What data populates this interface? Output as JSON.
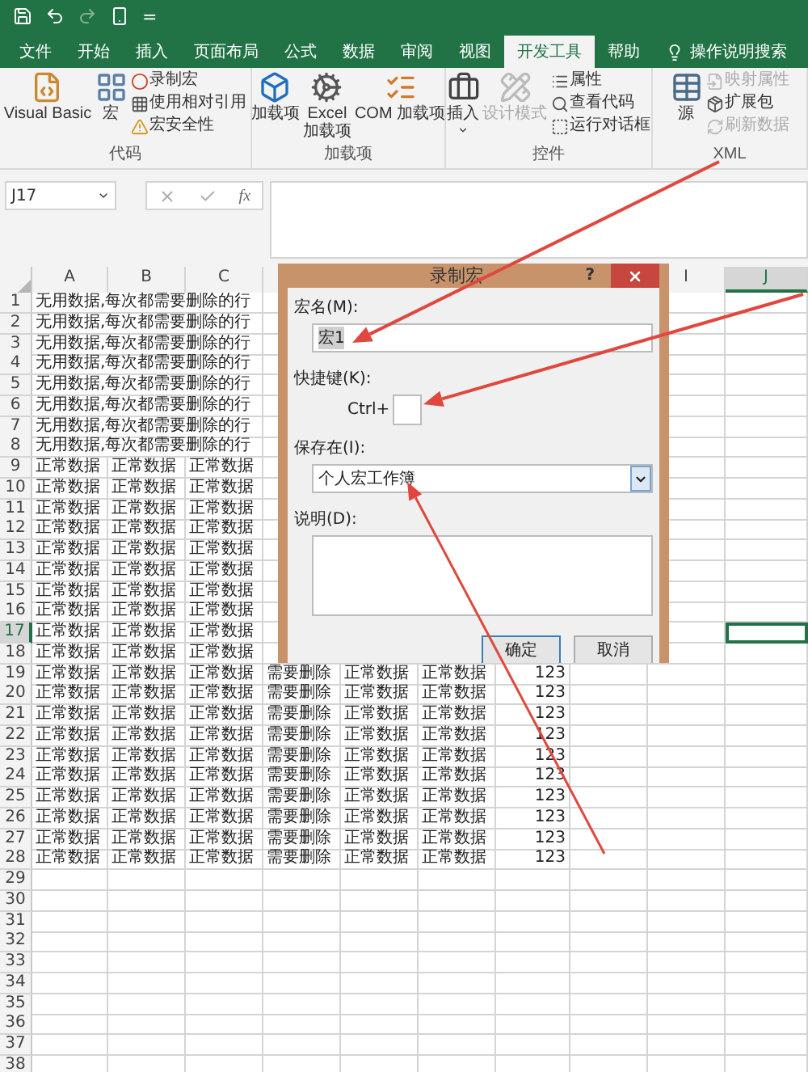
{
  "quick_access": {
    "customize": "="
  },
  "tabs": [
    {
      "label": "文件",
      "selected": false
    },
    {
      "label": "开始",
      "selected": false
    },
    {
      "label": "插入",
      "selected": false
    },
    {
      "label": "页面布局",
      "selected": false
    },
    {
      "label": "公式",
      "selected": false
    },
    {
      "label": "数据",
      "selected": false
    },
    {
      "label": "审阅",
      "selected": false
    },
    {
      "label": "视图",
      "selected": false
    },
    {
      "label": "开发工具",
      "selected": true
    },
    {
      "label": "帮助",
      "selected": false
    },
    {
      "label": "操作说明搜索",
      "selected": false,
      "kind": "search"
    }
  ],
  "ribbon": {
    "groups": [
      {
        "label": "代码",
        "items": [
          {
            "label": "Visual Basic",
            "kind": "large",
            "disabled": false
          },
          {
            "label": "宏",
            "kind": "large",
            "disabled": false
          },
          {
            "label": "录制宏",
            "kind": "small",
            "disabled": false
          },
          {
            "label": "使用相对引用",
            "kind": "small",
            "disabled": false
          },
          {
            "label": "宏安全性",
            "kind": "small",
            "disabled": false
          }
        ]
      },
      {
        "label": "加载项",
        "items": [
          {
            "label": "加载项",
            "kind": "large",
            "disabled": false
          },
          {
            "label": "Excel\n加载项",
            "kind": "large",
            "disabled": false
          },
          {
            "label": "COM 加载项",
            "kind": "large",
            "disabled": false
          }
        ]
      },
      {
        "label": "控件",
        "items": [
          {
            "label": "插入",
            "kind": "large",
            "disabled": false,
            "menu": true
          },
          {
            "label": "设计模式",
            "kind": "large",
            "disabled": true
          },
          {
            "label": "属性",
            "kind": "small",
            "disabled": false
          },
          {
            "label": "查看代码",
            "kind": "small",
            "disabled": false
          },
          {
            "label": "运行对话框",
            "kind": "small",
            "disabled": false
          }
        ]
      },
      {
        "label": "XML",
        "items": [
          {
            "label": "源",
            "kind": "large",
            "disabled": false
          },
          {
            "label": "映射属性",
            "kind": "small",
            "disabled": true
          },
          {
            "label": "扩展包",
            "kind": "small",
            "disabled": false
          },
          {
            "label": "刷新数据",
            "kind": "small",
            "disabled": true
          }
        ]
      }
    ]
  },
  "formula_bar": {
    "name_box": "J17",
    "function_button": "fx"
  },
  "sheet": {
    "columns": [
      {
        "label": "A",
        "selected": false,
        "kind": "text"
      },
      {
        "label": "B",
        "selected": false,
        "kind": "text"
      },
      {
        "label": "C",
        "selected": false,
        "kind": "text"
      },
      {
        "kind": "text"
      },
      {
        "kind": "text"
      },
      {
        "kind": "text"
      },
      {
        "kind": "number"
      },
      {
        "kind": "text"
      },
      {
        "label": "I",
        "selected": false,
        "kind": "text"
      },
      {
        "label": "J",
        "selected": true,
        "kind": "text"
      }
    ],
    "rows": [
      {
        "number": "1",
        "kind": "note",
        "selected": false,
        "cells": [
          "无用数据,每次都需要删除的行"
        ]
      },
      {
        "number": "2",
        "kind": "note",
        "selected": false,
        "cells": [
          "无用数据,每次都需要删除的行"
        ]
      },
      {
        "number": "3",
        "kind": "note",
        "selected": false,
        "cells": [
          "无用数据,每次都需要删除的行"
        ]
      },
      {
        "number": "4",
        "kind": "note",
        "selected": false,
        "cells": [
          "无用数据,每次都需要删除的行"
        ]
      },
      {
        "number": "5",
        "kind": "note",
        "selected": false,
        "cells": [
          "无用数据,每次都需要删除的行"
        ]
      },
      {
        "number": "6",
        "kind": "note",
        "selected": false,
        "cells": [
          "无用数据,每次都需要删除的行"
        ]
      },
      {
        "number": "7",
        "kind": "note",
        "selected": false,
        "cells": [
          "无用数据,每次都需要删除的行"
        ]
      },
      {
        "number": "8",
        "kind": "note",
        "selected": false,
        "cells": [
          "无用数据,每次都需要删除的行"
        ]
      },
      {
        "number": "9",
        "kind": "data",
        "selected": false,
        "cells": [
          "正常数据",
          "正常数据",
          "正常数据"
        ]
      },
      {
        "number": "10",
        "kind": "data",
        "selected": false,
        "cells": [
          "正常数据",
          "正常数据",
          "正常数据"
        ]
      },
      {
        "number": "11",
        "kind": "data",
        "selected": false,
        "cells": [
          "正常数据",
          "正常数据",
          "正常数据"
        ]
      },
      {
        "number": "12",
        "kind": "data",
        "selected": false,
        "cells": [
          "正常数据",
          "正常数据",
          "正常数据"
        ]
      },
      {
        "number": "13",
        "kind": "data",
        "selected": false,
        "cells": [
          "正常数据",
          "正常数据",
          "正常数据"
        ]
      },
      {
        "number": "14",
        "kind": "data",
        "selected": false,
        "cells": [
          "正常数据",
          "正常数据",
          "正常数据"
        ]
      },
      {
        "number": "15",
        "kind": "data",
        "selected": false,
        "cells": [
          "正常数据",
          "正常数据",
          "正常数据"
        ]
      },
      {
        "number": "16",
        "kind": "data",
        "selected": false,
        "cells": [
          "正常数据",
          "正常数据",
          "正常数据"
        ]
      },
      {
        "number": "17",
        "kind": "data",
        "selected": true,
        "cells": [
          "正常数据",
          "正常数据",
          "正常数据"
        ]
      },
      {
        "number": "18",
        "kind": "data",
        "selected": false,
        "cells": [
          "正常数据",
          "正常数据",
          "正常数据"
        ]
      },
      {
        "number": "19",
        "kind": "data",
        "selected": false,
        "cells": [
          "正常数据",
          "正常数据",
          "正常数据",
          "需要删除",
          "正常数据",
          "正常数据",
          "123"
        ]
      },
      {
        "number": "20",
        "kind": "data",
        "selected": false,
        "cells": [
          "正常数据",
          "正常数据",
          "正常数据",
          "需要删除",
          "正常数据",
          "正常数据",
          "123"
        ]
      },
      {
        "number": "21",
        "kind": "data",
        "selected": false,
        "cells": [
          "正常数据",
          "正常数据",
          "正常数据",
          "需要删除",
          "正常数据",
          "正常数据",
          "123"
        ]
      },
      {
        "number": "22",
        "kind": "data",
        "selected": false,
        "cells": [
          "正常数据",
          "正常数据",
          "正常数据",
          "需要删除",
          "正常数据",
          "正常数据",
          "123"
        ]
      },
      {
        "number": "23",
        "kind": "data",
        "selected": false,
        "cells": [
          "正常数据",
          "正常数据",
          "正常数据",
          "需要删除",
          "正常数据",
          "正常数据",
          "123"
        ]
      },
      {
        "number": "24",
        "kind": "data",
        "selected": false,
        "cells": [
          "正常数据",
          "正常数据",
          "正常数据",
          "需要删除",
          "正常数据",
          "正常数据",
          "123"
        ]
      },
      {
        "number": "25",
        "kind": "data",
        "selected": false,
        "cells": [
          "正常数据",
          "正常数据",
          "正常数据",
          "需要删除",
          "正常数据",
          "正常数据",
          "123"
        ]
      },
      {
        "number": "26",
        "kind": "data",
        "selected": false,
        "cells": [
          "正常数据",
          "正常数据",
          "正常数据",
          "需要删除",
          "正常数据",
          "正常数据",
          "123"
        ]
      },
      {
        "number": "27",
        "kind": "data",
        "selected": false,
        "cells": [
          "正常数据",
          "正常数据",
          "正常数据",
          "需要删除",
          "正常数据",
          "正常数据",
          "123"
        ]
      },
      {
        "number": "28",
        "kind": "data",
        "selected": false,
        "cells": [
          "正常数据",
          "正常数据",
          "正常数据",
          "需要删除",
          "正常数据",
          "正常数据",
          "123"
        ]
      },
      {
        "number": "29",
        "kind": "empty",
        "selected": false
      },
      {
        "number": "30",
        "kind": "empty",
        "selected": false
      },
      {
        "number": "31",
        "kind": "empty",
        "selected": false
      },
      {
        "number": "32",
        "kind": "empty",
        "selected": false
      },
      {
        "number": "33",
        "kind": "empty",
        "selected": false
      },
      {
        "number": "34",
        "kind": "empty",
        "selected": false
      },
      {
        "number": "35",
        "kind": "empty",
        "selected": false
      },
      {
        "number": "36",
        "kind": "empty",
        "selected": false
      },
      {
        "number": "37",
        "kind": "empty",
        "selected": false
      },
      {
        "number": "38",
        "kind": "empty",
        "selected": false
      }
    ]
  },
  "dialog": {
    "title": "录制宏",
    "help": "?",
    "macro_name": {
      "label": "宏名(M):",
      "value": "宏1"
    },
    "shortcut": {
      "label": "快捷键(K):",
      "prefix": "Ctrl+"
    },
    "store_in": {
      "label": "保存在(I):",
      "value": "个人宏工作簿"
    },
    "description": {
      "label": "说明(D):"
    },
    "buttons": [
      {
        "label": "确定",
        "selected": true
      },
      {
        "label": "取消",
        "selected": false
      }
    ]
  }
}
